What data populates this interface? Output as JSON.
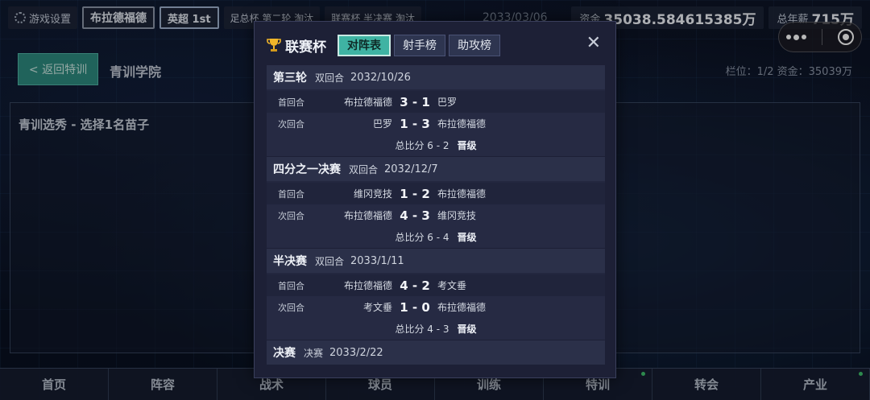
{
  "topbar": {
    "settings_label": "游戏设置",
    "club": "布拉德福德",
    "league": "英超 1st",
    "fa_cup": "足总杯 第二轮 淘汰",
    "league_cup": "联赛杯 半决赛 淘汰",
    "date": "2033/03/06",
    "funds_label": "资金",
    "funds_value": "35038.584615385万",
    "salary_label": "总年薪",
    "salary_value": "715万"
  },
  "page": {
    "back_label": "< 返回特训",
    "title": "青训学院",
    "slot_info": "栏位：1/2   资金：35039万",
    "youth_title": "青训选秀 - 选择1名苗子"
  },
  "bottomnav": {
    "items": [
      {
        "label": "首页"
      },
      {
        "label": "阵容"
      },
      {
        "label": "战术"
      },
      {
        "label": "球员"
      },
      {
        "label": "训练"
      },
      {
        "label": "特训"
      },
      {
        "label": "转会"
      },
      {
        "label": "产业"
      }
    ]
  },
  "modal": {
    "title": "联赛杯",
    "tabs": [
      {
        "label": "对阵表",
        "active": true
      },
      {
        "label": "射手榜",
        "active": false
      },
      {
        "label": "助攻榜",
        "active": false
      }
    ],
    "close": "✕",
    "rounds": [
      {
        "name": "第三轮",
        "type": "双回合",
        "date": "2032/10/26",
        "legs": [
          {
            "leg": "首回合",
            "home": "布拉德福德",
            "score": "3 - 1",
            "away": "巴罗"
          },
          {
            "leg": "次回合",
            "home": "巴罗",
            "score": "1 - 3",
            "away": "布拉德福德"
          }
        ],
        "agg_label": "总比分 6 - 2",
        "agg_result": "晋级"
      },
      {
        "name": "四分之一决赛",
        "type": "双回合",
        "date": "2032/12/7",
        "legs": [
          {
            "leg": "首回合",
            "home": "维冈竞技",
            "score": "1 - 2",
            "away": "布拉德福德"
          },
          {
            "leg": "次回合",
            "home": "布拉德福德",
            "score": "4 - 3",
            "away": "维冈竞技"
          }
        ],
        "agg_label": "总比分 6 - 4",
        "agg_result": "晋级"
      },
      {
        "name": "半决赛",
        "type": "双回合",
        "date": "2033/1/11",
        "legs": [
          {
            "leg": "首回合",
            "home": "布拉德福德",
            "score": "4 - 2",
            "away": "考文垂"
          },
          {
            "leg": "次回合",
            "home": "考文垂",
            "score": "1 - 0",
            "away": "布拉德福德"
          }
        ],
        "agg_label": "总比分 4 - 3",
        "agg_result": "晋级"
      },
      {
        "name": "决赛",
        "type": "决赛",
        "date": "2033/2/22",
        "legs": [],
        "agg_label": "",
        "agg_result": ""
      }
    ]
  },
  "colors": {
    "accent": "#3fb3a3",
    "modal_bg": "#1d2036",
    "back_button": "#2d8a7e"
  }
}
